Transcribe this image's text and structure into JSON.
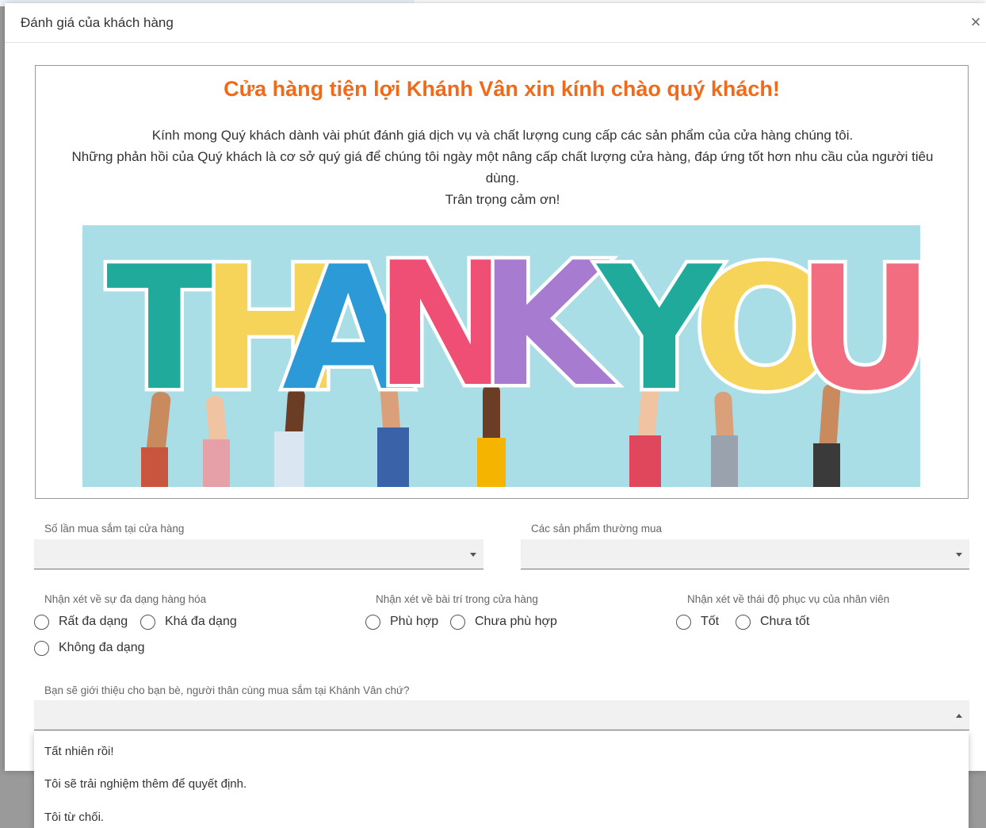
{
  "dialog": {
    "title": "Đánh giá của khách hàng",
    "close_label": "×"
  },
  "welcome": {
    "heading": "Cửa hàng tiện lợi Khánh Vân xin kính chào quý khách!",
    "lines": [
      "Kính mong Quý khách dành vài phút đánh giá dịch vụ và chất lượng cung cấp các sản phẩm của cửa hàng chúng tôi.",
      "Những phản hồi của Quý khách là cơ sở quý giá để chúng tôi ngày một nâng cấp chất lượng cửa hàng, đáp ứng tốt hơn nhu cầu của người tiêu dùng.",
      "Trân trọng cảm ơn!"
    ],
    "banner_letters": [
      "T",
      "H",
      "A",
      "N",
      "K",
      "Y",
      "O",
      "U"
    ]
  },
  "colors": {
    "accent": "#f06a1a",
    "banner_bg": "#a9dee7",
    "letter_teal": "#1faa9b",
    "letter_yellow": "#f6d359",
    "letter_blue": "#2b9ad6",
    "letter_pink": "#ef4f75",
    "letter_purple": "#a77bd0",
    "letter_coral": "#f26d7f"
  },
  "form": {
    "visits": {
      "label": "Số lần mua sắm tại cửa hàng",
      "value": ""
    },
    "products": {
      "label": "Các sản phẩm thường mua",
      "value": ""
    },
    "variety": {
      "label": "Nhận xét về sự đa dạng hàng hóa",
      "options": [
        "Rất đa dạng",
        "Khá đa dạng",
        "Không đa dạng"
      ]
    },
    "layout": {
      "label": "Nhận xét về bài trí trong cửa hàng",
      "options": [
        "Phù hợp",
        "Chưa phù hợp"
      ]
    },
    "attitude": {
      "label": "Nhận xét về thái độ phục vụ của nhân viên",
      "options": [
        "Tốt",
        "Chưa tốt"
      ]
    },
    "recommend": {
      "label": "Bạn sẽ giới thiệu cho bạn bè, người thân cùng mua sắm tại Khánh Vân chứ?",
      "value": "",
      "options": [
        "Tất nhiên rồi!",
        "Tôi sẽ trải nghiệm thêm để quyết định.",
        "Tôi từ chối."
      ]
    }
  }
}
